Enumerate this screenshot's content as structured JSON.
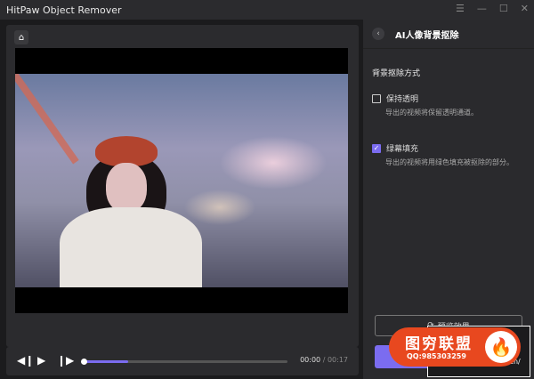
{
  "app": {
    "title": "HitPaw Object Remover"
  },
  "window_controls": {
    "menu": "☰",
    "minimize": "—",
    "maximize": "☐",
    "close": "✕"
  },
  "player": {
    "home_icon": "⌂",
    "current_time": "00:00",
    "separator": " / ",
    "total_time": "00:17",
    "progress_percent": 22
  },
  "panel": {
    "back": "‹",
    "title": "AI人像背景抠除",
    "section": "背景抠除方式",
    "options": [
      {
        "label": "保持透明",
        "description": "导出的视频将保留透明通道。",
        "checked": false
      },
      {
        "label": "绿幕填充",
        "description": "导出的视频将用绿色填充被抠除的部分。",
        "checked": true
      }
    ],
    "preview_label": "预览效果"
  },
  "watermark": {
    "text": "图穷联盟",
    "qq": "QQ:985303259",
    "suffix": ".cn/"
  },
  "colors": {
    "accent": "#7b6cf0",
    "watermark": "#e8481f"
  }
}
